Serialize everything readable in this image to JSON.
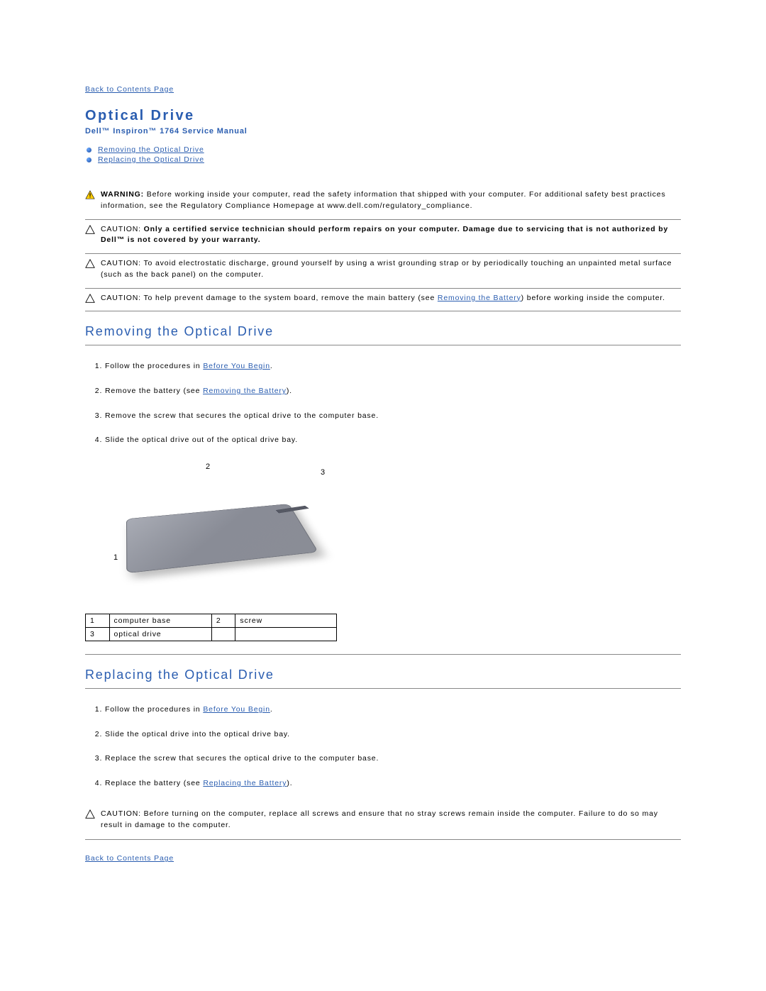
{
  "nav": {
    "back_to_contents": "Back to Contents Page"
  },
  "header": {
    "title": "Optical Drive",
    "subtitle": "Dell™ Inspiron™ 1764 Service Manual"
  },
  "toc": {
    "items": [
      {
        "label": "Removing the Optical Drive"
      },
      {
        "label": "Replacing the Optical Drive"
      }
    ]
  },
  "alerts": {
    "warning": {
      "prefix": "WARNING: ",
      "text": "Before working inside your computer, read the safety information that shipped with your computer. For additional safety best practices information, see the Regulatory Compliance Homepage at www.dell.com/regulatory_compliance."
    },
    "caution_auth": {
      "prefix": "CAUTION: ",
      "bold": "Only a certified service technician should perform repairs on your computer. Damage due to servicing that is not authorized by Dell™ is not covered by your warranty.",
      "text": ""
    },
    "caution_esd": {
      "prefix": "CAUTION: ",
      "text": "To avoid electrostatic discharge, ground yourself by using a wrist grounding strap or by periodically touching an unpainted metal surface (such as the back panel) on the computer."
    },
    "caution_battery": {
      "prefix": "CAUTION: ",
      "text_before": "To help prevent damage to the system board, remove the main battery (see ",
      "link": "Removing the Battery",
      "text_after": ") before working inside the computer."
    }
  },
  "sections": {
    "removing": {
      "title": "Removing the Optical Drive",
      "steps": [
        {
          "text_before": "Follow the procedures in ",
          "link": "Before You Begin",
          "text_after": "."
        },
        {
          "text_before": "Remove the battery (see ",
          "link": "Removing the Battery",
          "text_after": ")."
        },
        {
          "text_before": "Remove the screw that secures the optical drive to the computer base.",
          "link": "",
          "text_after": ""
        },
        {
          "text_before": "Slide the optical drive out of the optical drive bay.",
          "link": "",
          "text_after": ""
        }
      ],
      "parts": {
        "r1c1": "1",
        "r1c2": "computer base",
        "r1c3": "2",
        "r1c4": "screw",
        "r2c1": "3",
        "r2c2": "optical drive",
        "r2c3": "",
        "r2c4": ""
      },
      "callouts": {
        "c1": "1",
        "c2": "2",
        "c3": "3"
      }
    },
    "replacing": {
      "title": "Replacing the Optical Drive",
      "steps": [
        {
          "text_before": "Follow the procedures in ",
          "link": "Before You Begin",
          "text_after": "."
        },
        {
          "text_before": "Slide the optical drive into the optical drive bay.",
          "link": "",
          "text_after": ""
        },
        {
          "text_before": "Replace the screw that secures the optical drive to the computer base.",
          "link": "",
          "text_after": ""
        },
        {
          "text_before": "Replace the battery (see ",
          "link": "Replacing the Battery",
          "text_after": ")."
        }
      ]
    }
  },
  "caution_final": {
    "prefix": "CAUTION: ",
    "text": "Before turning on the computer, replace all screws and ensure that no stray screws remain inside the computer. Failure to do so may result in damage to the computer."
  }
}
